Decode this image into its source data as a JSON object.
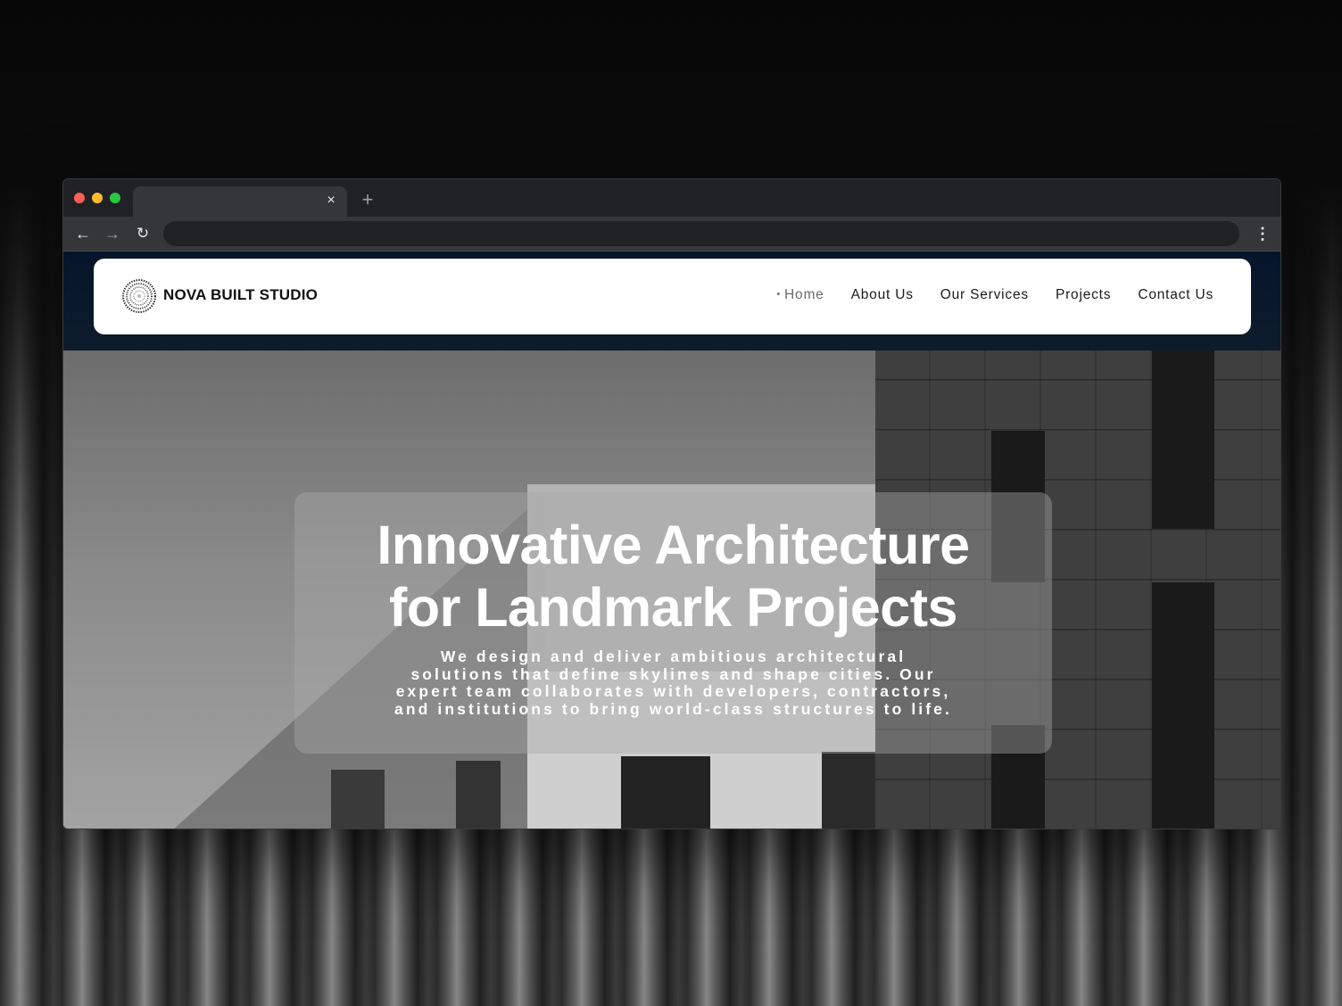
{
  "browser": {
    "tab": {
      "close_glyph": "×"
    },
    "new_tab_glyph": "+",
    "address_bar": {
      "value": "",
      "placeholder": ""
    },
    "icons": {
      "back": "←",
      "forward": "→",
      "reload": "↻",
      "menu": "⋮"
    }
  },
  "site": {
    "brand": "NOVA BUILT STUDIO",
    "nav": [
      {
        "label": "Home",
        "active": true
      },
      {
        "label": "About Us",
        "active": false
      },
      {
        "label": "Our Services",
        "active": false
      },
      {
        "label": "Projects",
        "active": false
      },
      {
        "label": "Contact Us",
        "active": false
      }
    ],
    "hero": {
      "title_line1": "Innovative Architecture",
      "title_line2": "for Landmark Projects",
      "subtitle": "We design and deliver ambitious architectural solutions that define skylines and shape cities. Our expert team collaborates with developers, contractors, and institutions to bring world-class structures to life."
    }
  },
  "colors": {
    "nav_background": "#06152a",
    "card_background": "#ffffff",
    "traffic_red": "#ff5f57",
    "traffic_yellow": "#febc2e",
    "traffic_green": "#28c840"
  }
}
